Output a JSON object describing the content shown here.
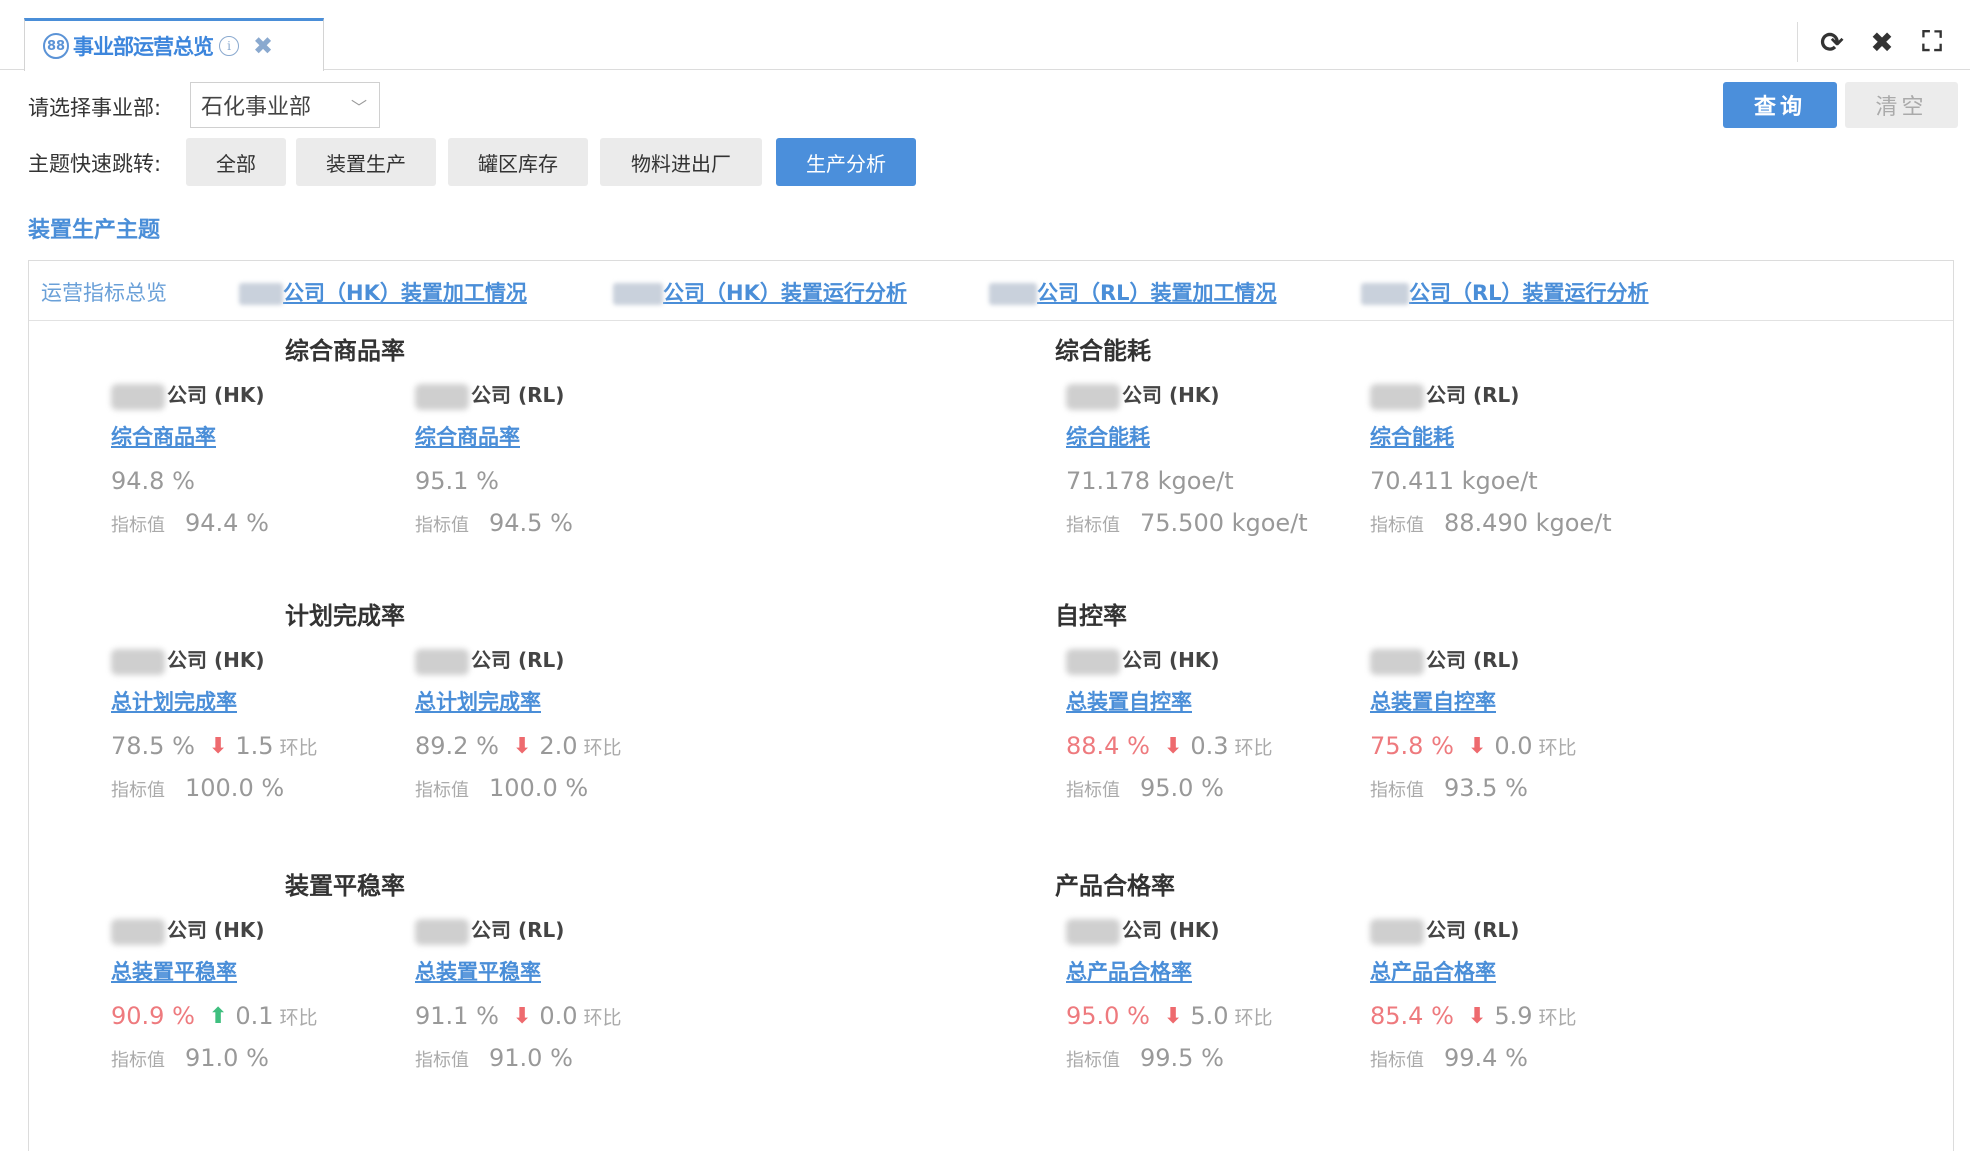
{
  "window": {
    "tab_icon": "88",
    "tab_title": "事业部运营总览",
    "info_icon": "i",
    "close_icon": "✖",
    "tools": {
      "refresh": "⟳",
      "close": "✖",
      "fullscreen": "⛶"
    }
  },
  "filters": {
    "division_label": "请选择事业部:",
    "division_value": "石化事业部",
    "query_label": "查询",
    "clear_label": "清空",
    "quick_label": "主题快速跳转:",
    "quick_buttons": [
      "全部",
      "装置生产",
      "罐区库存",
      "物料进出厂",
      "生产分析"
    ],
    "active_index": 4
  },
  "section_title": "装置生产主题",
  "subtabs": {
    "overview": "运营指标总览",
    "links": [
      "公司（HK）装置加工情况",
      "公司（HK）装置运行分析",
      "公司（RL）装置加工情况",
      "公司（RL）装置运行分析"
    ]
  },
  "labels": {
    "target": "指标值",
    "hb": "环比"
  },
  "groups": [
    {
      "title": "综合商品率",
      "cards": [
        {
          "company": "公司 (HK)",
          "metric": "综合商品率",
          "value": "94.8 %",
          "red": false,
          "trend": null,
          "change": "",
          "target": "94.4 %"
        },
        {
          "company": "公司 (RL)",
          "metric": "综合商品率",
          "value": "95.1 %",
          "red": false,
          "trend": null,
          "change": "",
          "target": "94.5 %"
        }
      ]
    },
    {
      "title": "综合能耗",
      "cards": [
        {
          "company": "公司 (HK)",
          "metric": "综合能耗",
          "value": "71.178 kgoe/t",
          "red": false,
          "trend": null,
          "change": "",
          "target": "75.500 kgoe/t"
        },
        {
          "company": "公司 (RL)",
          "metric": "综合能耗",
          "value": "70.411 kgoe/t",
          "red": false,
          "trend": null,
          "change": "",
          "target": "88.490 kgoe/t"
        }
      ]
    },
    {
      "title": "计划完成率",
      "cards": [
        {
          "company": "公司 (HK)",
          "metric": "总计划完成率",
          "value": "78.5 %",
          "red": false,
          "trend": "down",
          "change": "1.5",
          "target": "100.0 %"
        },
        {
          "company": "公司 (RL)",
          "metric": "总计划完成率",
          "value": "89.2 %",
          "red": false,
          "trend": "down",
          "change": "2.0",
          "target": "100.0 %"
        }
      ]
    },
    {
      "title": "自控率",
      "cards": [
        {
          "company": "公司 (HK)",
          "metric": "总装置自控率",
          "value": "88.4 %",
          "red": true,
          "trend": "down",
          "change": "0.3",
          "target": "95.0 %"
        },
        {
          "company": "公司 (RL)",
          "metric": "总装置自控率",
          "value": "75.8 %",
          "red": true,
          "trend": "down",
          "change": "0.0",
          "target": "93.5 %"
        }
      ]
    },
    {
      "title": "装置平稳率",
      "cards": [
        {
          "company": "公司 (HK)",
          "metric": "总装置平稳率",
          "value": "90.9 %",
          "red": true,
          "trend": "up",
          "change": "0.1",
          "target": "91.0 %"
        },
        {
          "company": "公司 (RL)",
          "metric": "总装置平稳率",
          "value": "91.1 %",
          "red": false,
          "trend": "down",
          "change": "0.0",
          "target": "91.0 %"
        }
      ]
    },
    {
      "title": "产品合格率",
      "cards": [
        {
          "company": "公司 (HK)",
          "metric": "总产品合格率",
          "value": "95.0 %",
          "red": true,
          "trend": "down",
          "change": "5.0",
          "target": "99.5 %"
        },
        {
          "company": "公司 (RL)",
          "metric": "总产品合格率",
          "value": "85.4 %",
          "red": true,
          "trend": "down",
          "change": "5.9",
          "target": "99.4 %"
        }
      ]
    }
  ]
}
